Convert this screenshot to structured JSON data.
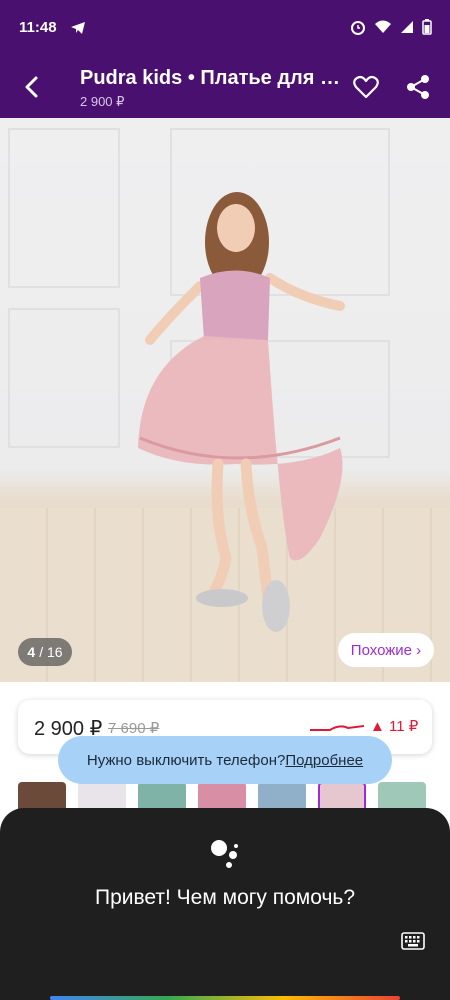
{
  "status_bar": {
    "time": "11:48",
    "icons": [
      "telegram-icon",
      "alarm-icon",
      "wifi-icon",
      "signal-icon",
      "battery-icon"
    ]
  },
  "app_bar": {
    "title": "Pudra kids • Платье для девочки",
    "price": "2 900 ₽",
    "icons": [
      "back-arrow-icon",
      "heart-icon",
      "share-icon"
    ]
  },
  "gallery": {
    "current": "4",
    "total": "/ 16",
    "similar_button": "Похожие ›"
  },
  "price_card": {
    "price": "2 900 ₽",
    "old_price": "7 690 ₽",
    "change": "▲ 11 ₽",
    "change_color": "#e0193a"
  },
  "toast": {
    "text": "Нужно выключить телефон?",
    "link": "Подробнее"
  },
  "thumbnails": {
    "count_visible": 7,
    "selected_index": 5
  },
  "assistant": {
    "greeting": "Привет! Чем могу помочь?",
    "icons": [
      "google-assistant-icon",
      "keyboard-icon"
    ]
  },
  "colors": {
    "brand": "#4a1070",
    "accent": "#a12bd2",
    "toast_bg": "#a8d1f7",
    "assistant_bg": "#1f1f1f"
  }
}
